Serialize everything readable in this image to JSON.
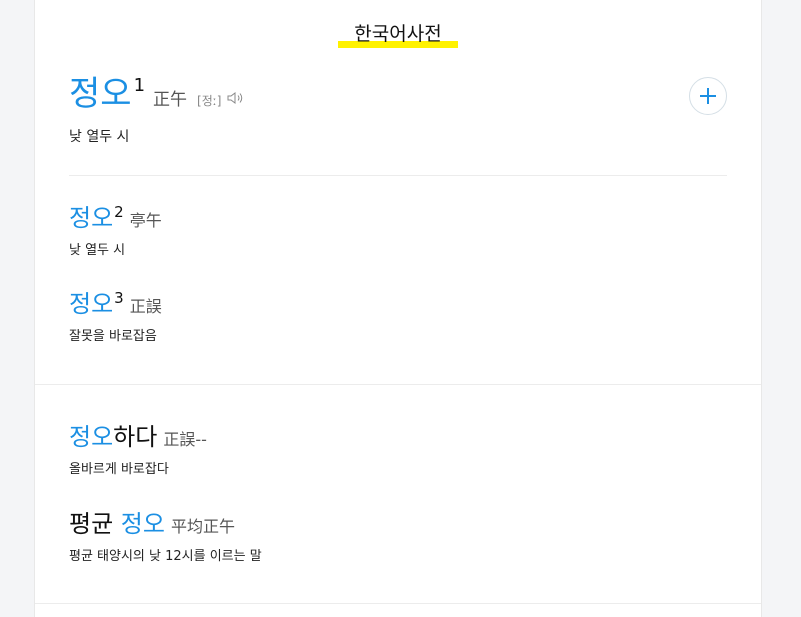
{
  "section": {
    "title": "한국어사전"
  },
  "main_entry": {
    "headword": "정오",
    "superscript": "1",
    "hanja": "正午",
    "pronunciation": "[정ː]",
    "definition": "낮 열두 시"
  },
  "entries": [
    {
      "headword": "정오",
      "superscript": "2",
      "hanja": "亭午",
      "definition": "낮 열두 시"
    },
    {
      "headword": "정오",
      "superscript": "3",
      "hanja": "正誤",
      "definition": "잘못을 바로잡음"
    }
  ],
  "related": [
    {
      "headword_highlight": "정오",
      "headword_rest": "하다",
      "hanja": "正誤--",
      "definition": "올바르게 바로잡다"
    },
    {
      "headword_prefix": "평균 ",
      "headword_highlight": "정오",
      "hanja": "平均正午",
      "definition": "평균 태양시의 낮 12시를 이르는 말"
    }
  ],
  "icons": {
    "speaker": "speaker-icon",
    "add": "plus-icon"
  },
  "colors": {
    "accent": "#1b8fe3",
    "highlight": "#fff200"
  }
}
